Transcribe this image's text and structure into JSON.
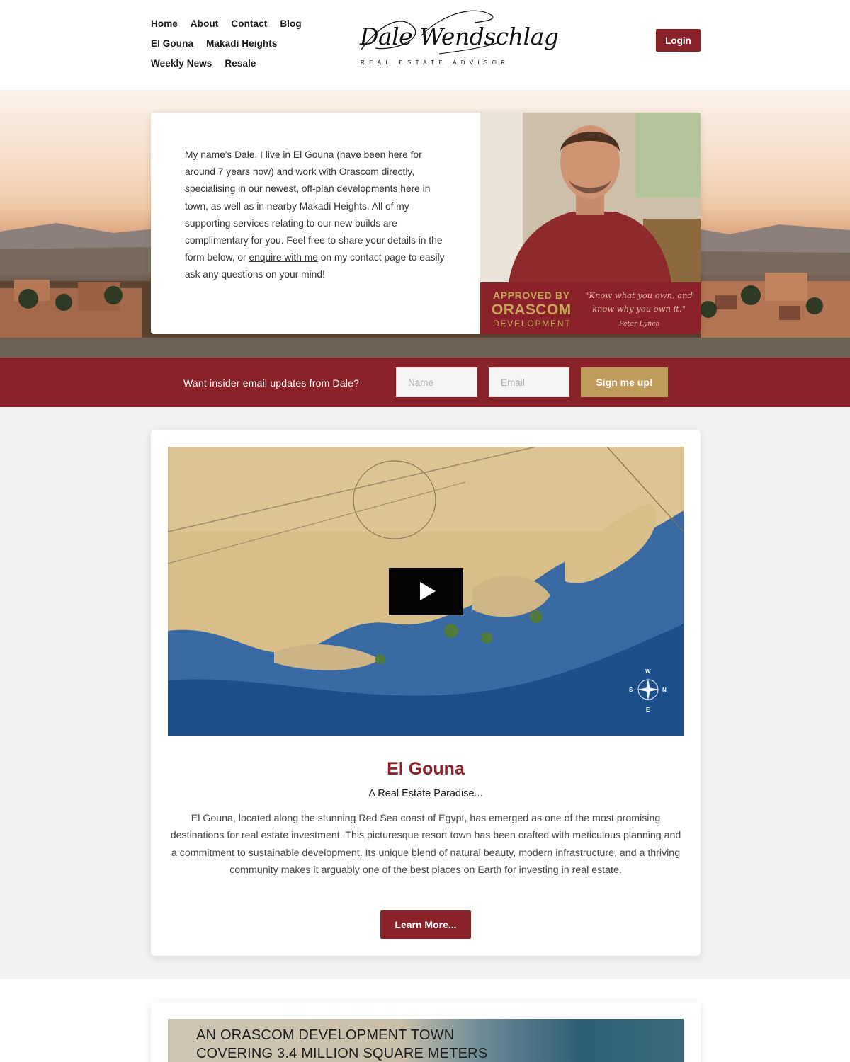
{
  "nav": {
    "items": [
      {
        "label": "Home"
      },
      {
        "label": "About"
      },
      {
        "label": "Contact"
      },
      {
        "label": "Blog"
      },
      {
        "label": "El Gouna"
      },
      {
        "label": "Makadi Heights"
      },
      {
        "label": "Weekly News"
      },
      {
        "label": "Resale"
      }
    ]
  },
  "logo": {
    "signature": "Dale Wendschlag",
    "subtitle": "REAL ESTATE ADVISOR"
  },
  "header": {
    "login_label": "Login"
  },
  "intro": {
    "text_before_link": "My name's Dale, I live in El Gouna (have been here for around 7 years now) and work with Orascom directly, specialising in our newest, off-plan developments here in town, as well as in nearby Makadi Heights. All of my supporting services relating to our new builds are complimentary for you. Feel free to share your details in the form below, or ",
    "link_text": "enquire with me",
    "text_after_link": " on my contact page to easily ask any questions on your mind!"
  },
  "approved": {
    "line1": "APPROVED BY",
    "line2": "ORASCOM",
    "line3": "DEVELOPMENT",
    "quote": "\"Know what you own, and know why you own it.\"",
    "author": "Peter Lynch"
  },
  "signup": {
    "prompt": "Want insider email updates from Dale?",
    "name_placeholder": "Name",
    "email_placeholder": "Email",
    "button_label": "Sign me up!"
  },
  "card": {
    "title": "El Gouna",
    "tagline": "A Real Estate Paradise...",
    "body": "El Gouna, located along the stunning Red Sea coast of Egypt, has emerged as one of the most promising destinations for real estate investment. This picturesque resort town has been crafted with meticulous planning and a commitment to sustainable development. Its unique blend of natural beauty, modern infrastructure, and a thriving community makes it arguably one of the best places on Earth for investing in real estate.",
    "button_label": "Learn More..."
  },
  "map": {
    "compass": {
      "w": "W",
      "n": "N",
      "s": "S",
      "e": "E"
    }
  },
  "card2": {
    "line1": "AN ORASCOM DEVELOPMENT TOWN",
    "line2": "COVERING 3.4 MILLION SQUARE METERS"
  },
  "colors": {
    "brand": "#8a2229",
    "gold": "#bf9c5c",
    "section_bg": "#f1f1f1"
  }
}
